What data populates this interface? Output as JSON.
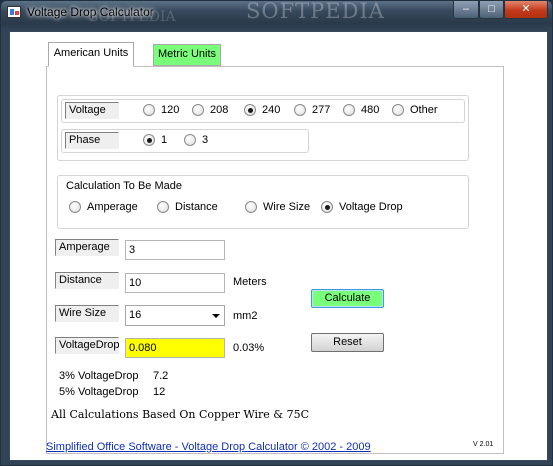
{
  "window": {
    "title": "Voltage Drop Calculator",
    "watermark": "SOFTPEDIA",
    "watermark_faint": "SOFTPEDIA",
    "controls": {
      "minimize": "–",
      "maximize": "□",
      "close": "✕"
    }
  },
  "tabs": [
    {
      "label": "American Units",
      "active": true
    },
    {
      "label": "Metric Units",
      "active": false
    }
  ],
  "voltage": {
    "label": "Voltage",
    "options": [
      "120",
      "208",
      "240",
      "277",
      "480",
      "Other"
    ],
    "selected": "240"
  },
  "phase": {
    "label": "Phase",
    "options": [
      "1",
      "3"
    ],
    "selected": "1"
  },
  "calculation": {
    "group_label": "Calculation To Be Made",
    "options": [
      "Amperage",
      "Distance",
      "Wire Size",
      "Voltage Drop"
    ],
    "selected": "Voltage Drop"
  },
  "inputs": {
    "amperage": {
      "label": "Amperage",
      "value": "3"
    },
    "distance": {
      "label": "Distance",
      "value": "10",
      "unit": "Meters"
    },
    "wire_size": {
      "label": "Wire Size",
      "value": "16",
      "unit": "mm2"
    },
    "voltage_drop": {
      "label": "VoltageDrop",
      "value": "0.080",
      "percent": "0.03%"
    }
  },
  "buttons": {
    "calculate": "Calculate",
    "reset": "Reset"
  },
  "results": {
    "three_pct_label": "3% VoltageDrop",
    "three_pct_value": "7.2",
    "five_pct_label": "5% VoltageDrop",
    "five_pct_value": "12"
  },
  "note": "All Calculations Based On Copper Wire & 75C",
  "footer": {
    "link": "Simplified Office Software - Voltage Drop  Calculator   ©  2002 - 2009",
    "version": "V 2.01"
  },
  "colors": {
    "tab_metric": "#7aff7a",
    "calculate_button": "#7aff7a",
    "result_field": "#ffff00",
    "link": "#1030b8"
  }
}
